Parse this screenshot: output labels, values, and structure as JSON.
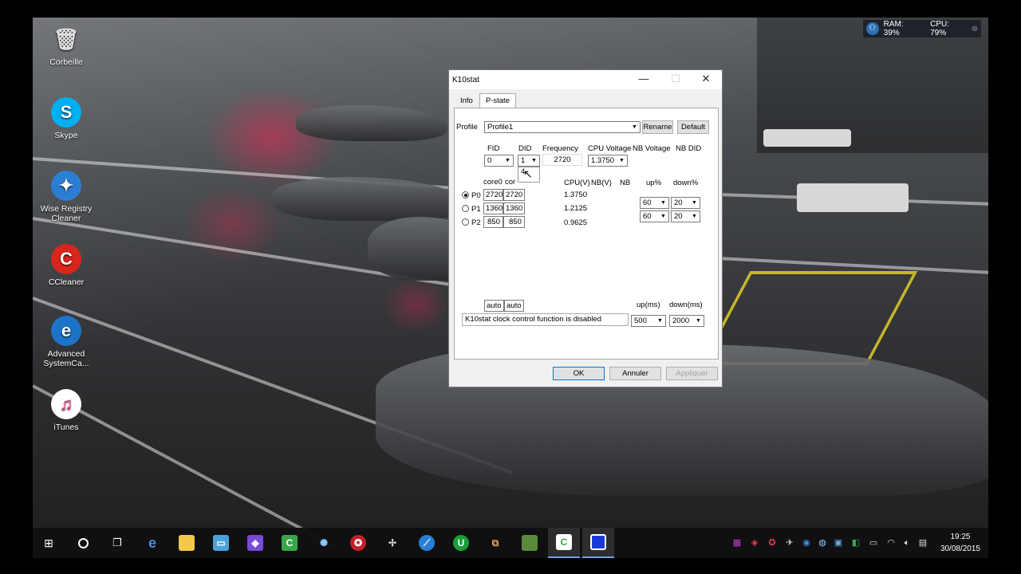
{
  "desktop": {
    "icons": [
      {
        "label": "Corbeille",
        "icon": "recycle-bin-icon"
      },
      {
        "label": "Skype",
        "icon": "skype-icon"
      },
      {
        "label": "Wise Registry Cleaner",
        "icon": "wise-registry-cleaner-icon"
      },
      {
        "label": "CCleaner",
        "icon": "ccleaner-icon"
      },
      {
        "label": "Advanced SystemCa...",
        "icon": "advanced-systemcare-icon"
      },
      {
        "label": "iTunes",
        "icon": "itunes-icon"
      }
    ],
    "meter": {
      "ram": "RAM: 39%",
      "cpu": "CPU: 79%"
    }
  },
  "window": {
    "title": "K10stat",
    "tabs": [
      "Info",
      "P-state"
    ],
    "active_tab": "P-state",
    "profile_label": "Profile",
    "profile_value": "Profile1",
    "rename_label": "Rename",
    "default_label": "Default",
    "headers": {
      "fid": "FID",
      "did": "DID",
      "frequency": "Frequency",
      "cpu_voltage": "CPU Voltage",
      "nb_voltage": "NB Voltage",
      "nb_did": "NB DID"
    },
    "fid_value": "0",
    "did_value": "1",
    "did_dropdown_peek": "4",
    "frequency_value": "2720",
    "cpu_voltage_value": "1.3750",
    "table_headers": {
      "core0": "core0",
      "core1": "cor",
      "cpu_v": "CPU(V)",
      "nb_v": "NB(V)",
      "nb": "NB",
      "up": "up%",
      "down": "down%"
    },
    "pstates": [
      {
        "name": "P0",
        "core0": "2720",
        "core1": "2720",
        "cpu_v": "1.3750",
        "selected": true
      },
      {
        "name": "P1",
        "core0": "1360",
        "core1": "1360",
        "cpu_v": "1.2125",
        "selected": false
      },
      {
        "name": "P2",
        "core0": "850",
        "core1": "850",
        "cpu_v": "0.9625",
        "selected": false
      }
    ],
    "thresholds": [
      {
        "up": "60",
        "down": "20"
      },
      {
        "up": "60",
        "down": "20"
      }
    ],
    "auto_fields": [
      "auto",
      "auto"
    ],
    "up_ms_label": "up(ms)",
    "down_ms_label": "down(ms)",
    "up_ms_value": "500",
    "down_ms_value": "2000",
    "status_text": "K10stat clock control function is disabled",
    "ok_label": "OK",
    "cancel_label": "Annuler",
    "apply_label": "Appliquer"
  },
  "taskbar": {
    "pinned": [
      "start-icon",
      "cortana-icon",
      "task-view-icon",
      "edge-icon",
      "file-explorer-icon",
      "app-icon",
      "app-icon",
      "camtasia-icon",
      "app-icon",
      "app-icon",
      "app-icon",
      "app-icon",
      "app-icon",
      "app-icon",
      "minecraft-icon",
      "camtasia-icon",
      "app-icon"
    ],
    "clock_time": "19:25",
    "clock_date": "30/08/2015"
  },
  "colors": {
    "accent": "#0078d7",
    "taskbar": "#101012",
    "window_bg": "#f0f0f0"
  }
}
